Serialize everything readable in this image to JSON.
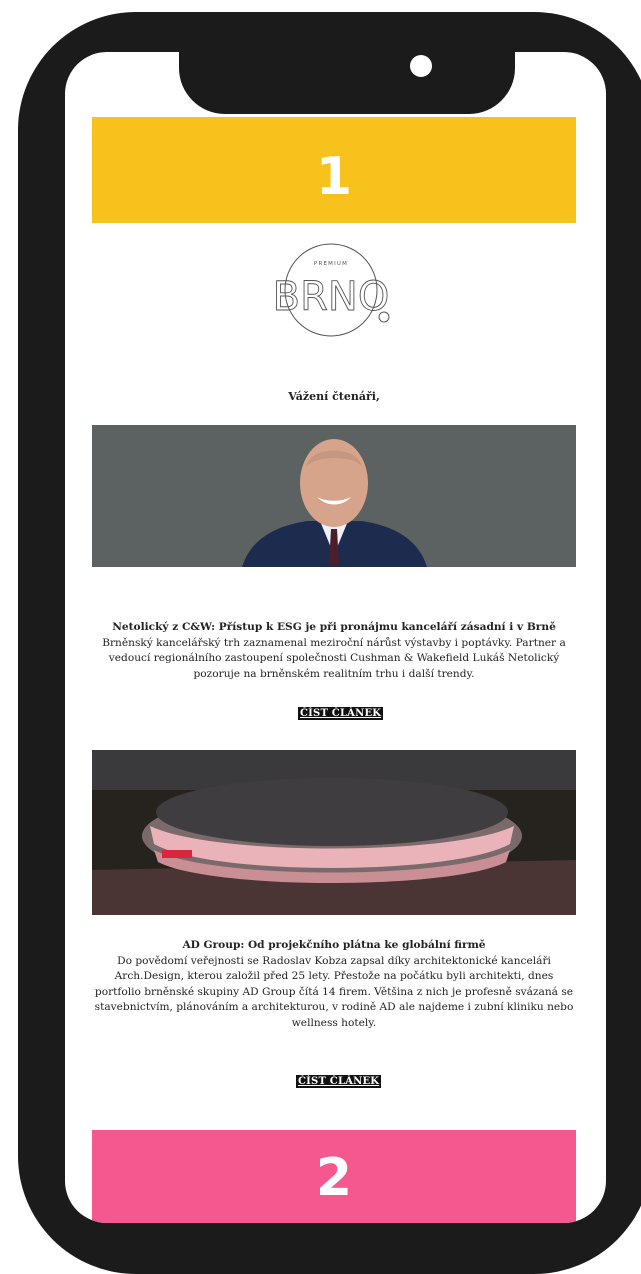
{
  "banners": {
    "top": "1",
    "bottom": "2"
  },
  "logo": {
    "small_text": "PREMIUM",
    "main_text": "BRNO"
  },
  "greeting": "Vážení čtenáři,",
  "articles": [
    {
      "headline": "Netolický z C&W: Přístup k ESG je při pronájmu kanceláří zásadní i v Brně",
      "body": "Brněnský kancelářský trh zaznamenal meziroční nárůst výstavby i poptávky. Partner a vedoucí regionálního zastoupení společnosti Cushman & Wakefield Lukáš Netolický pozoruje na brněnském realitním trhu i další trendy.",
      "cta": "ČÍST ČLÁNEK"
    },
    {
      "headline": "AD Group: Od projekčního plátna ke globální firmě",
      "body": "Do povědomí veřejnosti se Radoslav Kobza zapsal díky architektonické kanceláři Arch.Design, kterou založil před 25 lety. Přestože na počátku byli architekti, dnes portfolio brněnské skupiny AD Group čítá 14 firem. Většina z nich je profesně svázaná se stavebnictvím, plánováním a architekturou, v rodině AD ale najdeme i zubní kliniku nebo wellness hotely.",
      "cta": "ČÍST ČLÁNEK"
    }
  ],
  "colors": {
    "banner_top": "#f7c21b",
    "banner_bottom": "#f4588e",
    "phone_frame": "#1b1b1b"
  },
  "icons": {
    "camera": "camera-dot-icon"
  }
}
